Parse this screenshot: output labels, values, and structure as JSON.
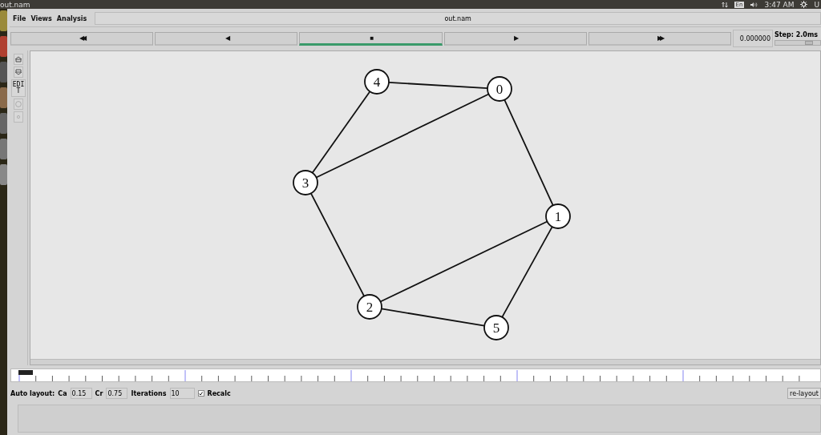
{
  "window": {
    "title": "out.nam"
  },
  "tray": {
    "keyboard": "En",
    "clock": "3:47 AM",
    "user": "U"
  },
  "menu": [
    {
      "label": "File"
    },
    {
      "label": "Views"
    },
    {
      "label": "Analysis"
    }
  ],
  "file_title": "out.nam",
  "playback_buttons": [
    {
      "symbol": "◀◀",
      "selected": false
    },
    {
      "symbol": "◀",
      "selected": false
    },
    {
      "symbol": "■",
      "selected": true
    },
    {
      "symbol": "▶",
      "selected": false
    },
    {
      "symbol": "▶▶",
      "selected": false
    }
  ],
  "time": "0.000000",
  "step": {
    "label": "Step: 2.0ms",
    "level": 0.75
  },
  "tools": [
    {
      "kind": "icon"
    },
    {
      "kind": "icon"
    },
    {
      "kind": "text",
      "label": "EDIT"
    },
    {
      "kind": "icon"
    },
    {
      "kind": "icon"
    }
  ],
  "nodes": [
    {
      "label": "0"
    },
    {
      "label": "1"
    },
    {
      "label": "2"
    },
    {
      "label": "3"
    },
    {
      "label": "4"
    },
    {
      "label": "5"
    }
  ],
  "auto_layout": {
    "label": "Auto layout:",
    "ca_label": "Ca",
    "ca": "0.15",
    "cr_label": "Cr",
    "cr": "0.75",
    "iterations_label": "Iterations",
    "iterations": "10",
    "recalc": {
      "label": "Recalc",
      "checked": true
    },
    "relayout_button": "re-layout"
  }
}
